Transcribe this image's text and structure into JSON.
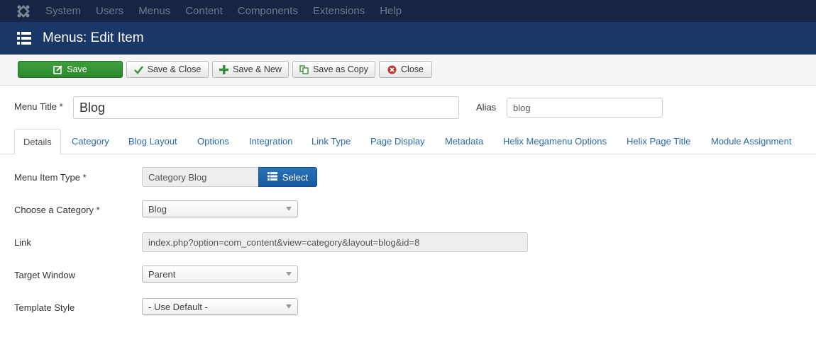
{
  "topnav": {
    "logo_icon": "joomla-logo-icon",
    "items": [
      "System",
      "Users",
      "Menus",
      "Content",
      "Components",
      "Extensions",
      "Help"
    ]
  },
  "header": {
    "icon": "list-icon",
    "title": "Menus: Edit Item"
  },
  "toolbar": {
    "save": "Save",
    "save_close": "Save & Close",
    "save_new": "Save & New",
    "save_copy": "Save as Copy",
    "close": "Close"
  },
  "form": {
    "menu_title_label": "Menu Title *",
    "menu_title_value": "Blog",
    "alias_label": "Alias",
    "alias_value": "blog"
  },
  "tabs": [
    "Details",
    "Category",
    "Blog Layout",
    "Options",
    "Integration",
    "Link Type",
    "Page Display",
    "Metadata",
    "Helix Megamenu Options",
    "Helix Page Title",
    "Module Assignment"
  ],
  "details": {
    "menu_item_type_label": "Menu Item Type *",
    "menu_item_type_value": "Category Blog",
    "select_button": "Select",
    "category_label": "Choose a Category *",
    "category_value": "Blog",
    "link_label": "Link",
    "link_value": "index.php?option=com_content&view=category&layout=blog&id=8",
    "target_label": "Target Window",
    "target_value": "Parent",
    "template_label": "Template Style",
    "template_value": "- Use Default -"
  },
  "colors": {
    "topnav": "#152543",
    "header": "#1a3867",
    "save": "#2f8f2f",
    "link": "#2a6aa8",
    "select_btn": "#1f5fa8"
  }
}
